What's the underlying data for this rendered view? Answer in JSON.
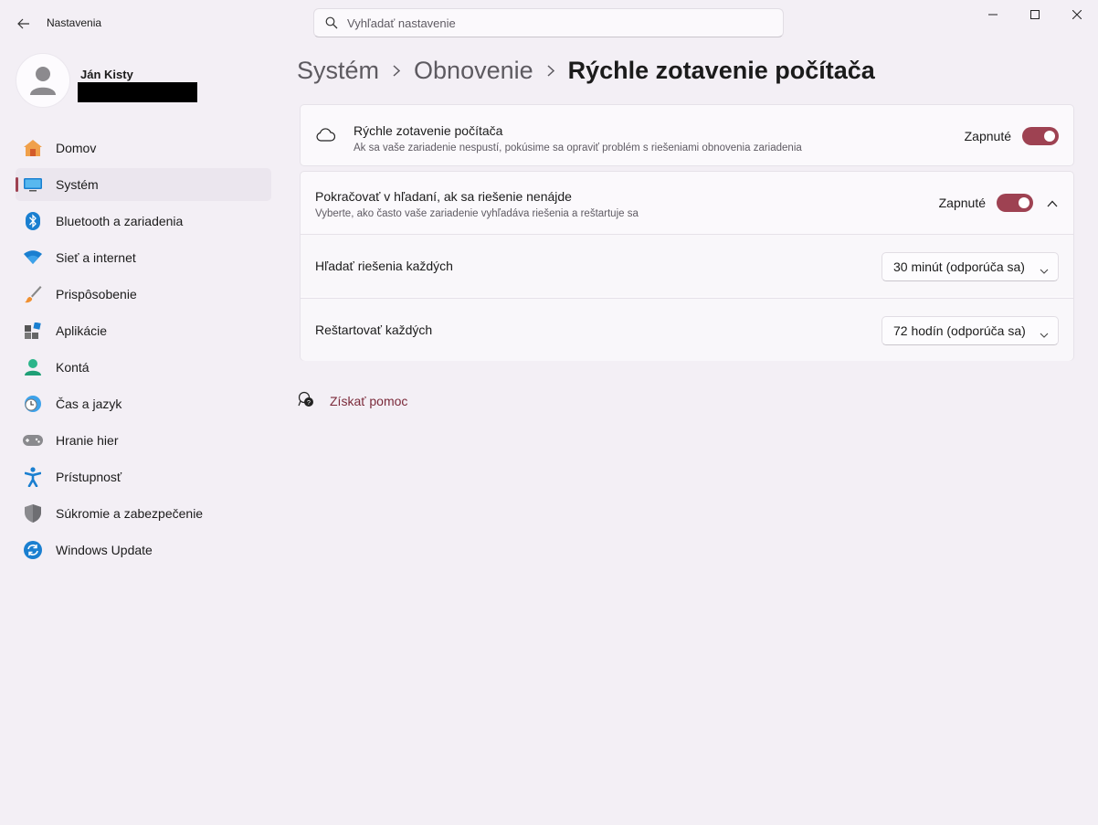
{
  "window": {
    "title": "Nastavenia",
    "search_placeholder": "Vyhľadať nastavenie"
  },
  "user": {
    "name": "Ján Kisty"
  },
  "sidebar": {
    "items": [
      {
        "label": "Domov",
        "icon": "home-icon"
      },
      {
        "label": "Systém",
        "icon": "system-icon",
        "active": true
      },
      {
        "label": "Bluetooth a zariadenia",
        "icon": "bluetooth-icon"
      },
      {
        "label": "Sieť a internet",
        "icon": "wifi-icon"
      },
      {
        "label": "Prispôsobenie",
        "icon": "brush-icon"
      },
      {
        "label": "Aplikácie",
        "icon": "apps-icon"
      },
      {
        "label": "Kontá",
        "icon": "account-icon"
      },
      {
        "label": "Čas a jazyk",
        "icon": "clock-globe-icon"
      },
      {
        "label": "Hranie hier",
        "icon": "gamepad-icon"
      },
      {
        "label": "Prístupnosť",
        "icon": "accessibility-icon"
      },
      {
        "label": "Súkromie a zabezpečenie",
        "icon": "shield-icon"
      },
      {
        "label": "Windows Update",
        "icon": "update-icon"
      }
    ]
  },
  "breadcrumb": {
    "items": [
      "Systém",
      "Obnovenie"
    ],
    "current": "Rýchle zotavenie počítača"
  },
  "quick_recovery": {
    "title": "Rýchle zotavenie počítača",
    "description": "Ak sa vaše zariadenie nespustí, pokúsime sa opraviť problém s riešeniami obnovenia zariadenia",
    "state_label": "Zapnuté",
    "enabled": true
  },
  "continue_search": {
    "title": "Pokračovať v hľadaní, ak sa riešenie nenájde",
    "description": "Vyberte, ako často vaše zariadenie vyhľadáva riešenia a reštartuje sa",
    "state_label": "Zapnuté",
    "enabled": true,
    "search_every": {
      "label": "Hľadať riešenia každých",
      "value": "30 minút (odporúča sa)"
    },
    "restart_every": {
      "label": "Reštartovať každých",
      "value": "72 hodín (odporúča sa)"
    }
  },
  "help": {
    "label": "Získať pomoc"
  },
  "colors": {
    "accent": "#9e4252",
    "link": "#7b2a3a",
    "background": "#f3eff5"
  }
}
